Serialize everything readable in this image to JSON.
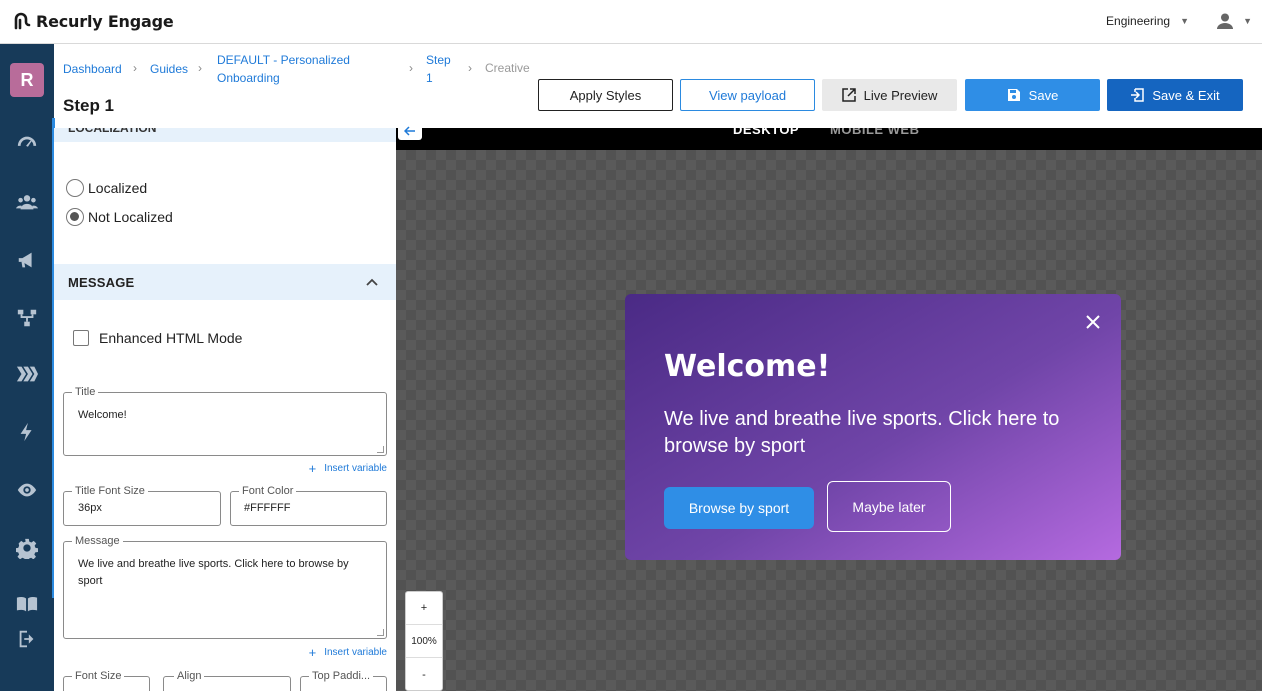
{
  "app": {
    "name": "Recurly Engage"
  },
  "topbar": {
    "org": "Engineering",
    "user_icon": "user-icon"
  },
  "nav": {
    "avatar_letter": "R",
    "items": [
      "dashboard-icon",
      "users-icon",
      "campaigns-icon",
      "flows-icon",
      "guides-icon",
      "lightning-icon",
      "eye-icon",
      "settings-icon",
      "docs-icon",
      "logout-icon"
    ]
  },
  "breadcrumb": {
    "items": [
      "Dashboard",
      "Guides",
      "DEFAULT - Personalized",
      "Onboarding",
      "Step",
      "1"
    ],
    "current": "Creative"
  },
  "page": {
    "title": "Step 1"
  },
  "toolbar": {
    "apply_styles": "Apply Styles",
    "view_payload": "View payload",
    "live_preview": "Live Preview",
    "save": "Save",
    "save_exit": "Save & Exit"
  },
  "localization": {
    "options": [
      "Localized",
      "Not Localized"
    ],
    "selected": "Not Localized"
  },
  "message_section": {
    "heading": "MESSAGE",
    "enhanced_html": "Enhanced HTML Mode",
    "title_label": "Title",
    "title_value": "Welcome!",
    "insert_variable": "Insert variable",
    "title_font_size_label": "Title Font Size",
    "title_font_size": "36px",
    "font_color_label": "Font Color",
    "font_color": "#FFFFFF",
    "message_label": "Message",
    "message_value": "We live and breathe live sports. Click here to browse by sport",
    "font_size_label": "Font Size",
    "align_label": "Align",
    "top_padding_label": "Top Paddi..."
  },
  "canvas": {
    "tabs": [
      "DESKTOP",
      "MOBILE WEB"
    ],
    "active_tab": "DESKTOP",
    "zoom_in": "+",
    "zoom_level": "100%",
    "zoom_out": "-"
  },
  "preview": {
    "title": "Welcome!",
    "message": "We live and breathe live sports. Click here to browse by sport",
    "primary_button": "Browse by sport",
    "secondary_button": "Maybe later",
    "colors": {
      "gradient_start": "#4a2a85",
      "gradient_end": "#b56ae0",
      "primary_button": "#2f8ee6"
    }
  }
}
